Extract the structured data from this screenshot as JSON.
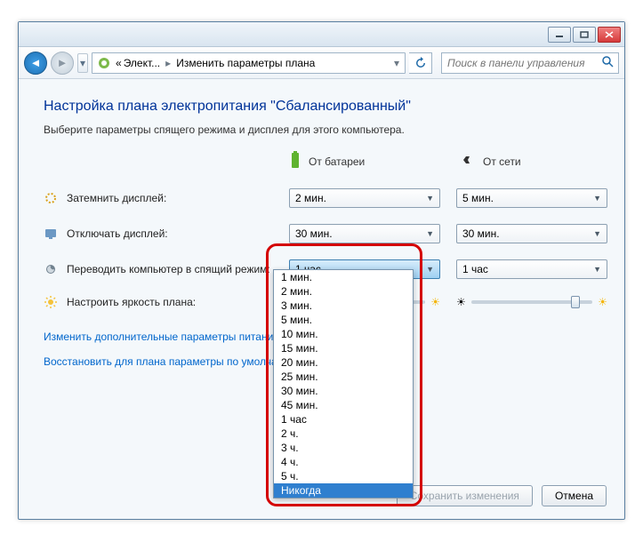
{
  "breadcrumb": {
    "prefix": "«",
    "part1": "Элект...",
    "part2": "Изменить параметры плана"
  },
  "search": {
    "placeholder": "Поиск в панели управления"
  },
  "heading": "Настройка плана электропитания \"Сбалансированный\"",
  "subtext": "Выберите параметры спящего режима и дисплея для этого компьютера.",
  "columns": {
    "battery": "От батареи",
    "plugged": "От сети"
  },
  "rows": {
    "dim": {
      "label": "Затемнить дисплей:",
      "battery": "2 мин.",
      "plugged": "5 мин."
    },
    "off": {
      "label": "Отключать дисплей:",
      "battery": "30 мин.",
      "plugged": "30 мин."
    },
    "sleep": {
      "label": "Переводить компьютер в спящий режим:",
      "battery": "1 час",
      "plugged": "1 час"
    },
    "bright": {
      "label": "Настроить яркость плана:"
    }
  },
  "dropdown": {
    "items": [
      "1 мин.",
      "2 мин.",
      "3 мин.",
      "5 мин.",
      "10 мин.",
      "15 мин.",
      "20 мин.",
      "25 мин.",
      "30 мин.",
      "45 мин.",
      "1 час",
      "2 ч.",
      "3 ч.",
      "4 ч.",
      "5 ч.",
      "Никогда"
    ],
    "highlighted": "Никогда"
  },
  "links": {
    "advanced": "Изменить дополнительные параметры питания",
    "restore": "Восстановить для плана параметры по умолчанию"
  },
  "buttons": {
    "save": "Сохранить изменения",
    "cancel": "Отмена"
  }
}
